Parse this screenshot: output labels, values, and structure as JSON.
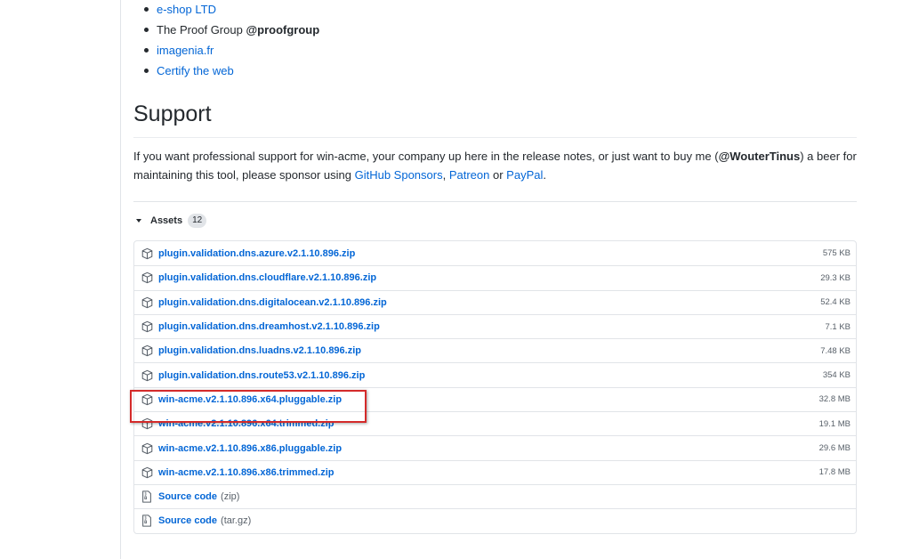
{
  "sponsors": [
    {
      "text": "e-shop LTD",
      "link": true
    },
    {
      "prefix": "The Proof Group ",
      "bold": "@proofgroup",
      "link": false
    },
    {
      "text": "imagenia.fr",
      "link": true
    },
    {
      "text": "Certify the web",
      "link": true
    }
  ],
  "support": {
    "title": "Support",
    "text_1": "If you want professional support for win-acme, your company up here in the release notes, or just want to buy me (",
    "handle": "@WouterTinus",
    "text_2": ") a beer for maintaining this tool, please sponsor using ",
    "link_github": "GitHub Sponsors",
    "sep_1": ", ",
    "link_patreon": "Patreon",
    "sep_2": " or ",
    "link_paypal": "PayPal",
    "end": "."
  },
  "assets": {
    "label": "Assets",
    "count": "12",
    "files": [
      {
        "name": "plugin.validation.dns.azure.v2.1.10.896.zip",
        "size": "575 KB"
      },
      {
        "name": "plugin.validation.dns.cloudflare.v2.1.10.896.zip",
        "size": "29.3 KB"
      },
      {
        "name": "plugin.validation.dns.digitalocean.v2.1.10.896.zip",
        "size": "52.4 KB"
      },
      {
        "name": "plugin.validation.dns.dreamhost.v2.1.10.896.zip",
        "size": "7.1 KB"
      },
      {
        "name": "plugin.validation.dns.luadns.v2.1.10.896.zip",
        "size": "7.48 KB"
      },
      {
        "name": "plugin.validation.dns.route53.v2.1.10.896.zip",
        "size": "354 KB"
      },
      {
        "name": "win-acme.v2.1.10.896.x64.pluggable.zip",
        "size": "32.8 MB"
      },
      {
        "name": "win-acme.v2.1.10.896.x64.trimmed.zip",
        "size": "19.1 MB"
      },
      {
        "name": "win-acme.v2.1.10.896.x86.pluggable.zip",
        "size": "29.6 MB"
      },
      {
        "name": "win-acme.v2.1.10.896.x86.trimmed.zip",
        "size": "17.8 MB"
      }
    ],
    "source": [
      {
        "label": "Source code",
        "ext": "(zip)"
      },
      {
        "label": "Source code",
        "ext": "(tar.gz)"
      }
    ]
  },
  "colors": {
    "link": "#0366d6",
    "text": "#24292e",
    "muted": "#586069",
    "highlight": "#d42a2a"
  },
  "icons": {
    "package": "package-icon",
    "file_zip": "file-zip-icon",
    "caret": "triangle-down-icon"
  }
}
